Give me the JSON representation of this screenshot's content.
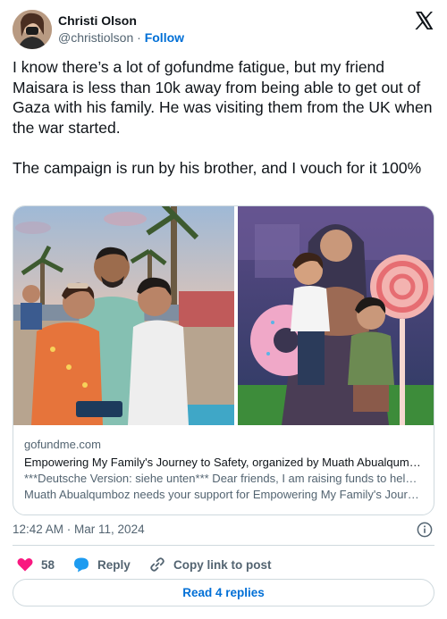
{
  "author": {
    "name": "Christi Olson",
    "handle": "@christiolson",
    "separator": "·",
    "follow_label": "Follow"
  },
  "tweet": {
    "paragraphs": [
      "I know there’s a lot of gofundme fatigue, but my friend Maisara is less than 10k away from being able to get out of Gaza with his family. He was visiting them from the UK when the war started.",
      "The campaign is run by his brother, and I vouch for it 100%"
    ]
  },
  "link_card": {
    "domain": "gofundme.com",
    "title": "Empowering My Family's Journey to Safety, organized by Muath Abualqumboz",
    "description_line1": "***Deutsche Version: siehe unten*** Dear friends, I am raising funds to help my family…",
    "description_line2": "Muath Abualqumboz needs your support for Empowering My Family's Journey to Safety"
  },
  "meta": {
    "timestamp": "12:42 AM · Mar 11, 2024"
  },
  "actions": {
    "like_count": "58",
    "reply_label": "Reply",
    "copy_label": "Copy link to post"
  },
  "replies_button": "Read 4 replies",
  "colors": {
    "accent": "#006fd6",
    "like": "#f91880",
    "text": "#0f1419",
    "muted": "#536471",
    "border": "#cfd9de"
  }
}
